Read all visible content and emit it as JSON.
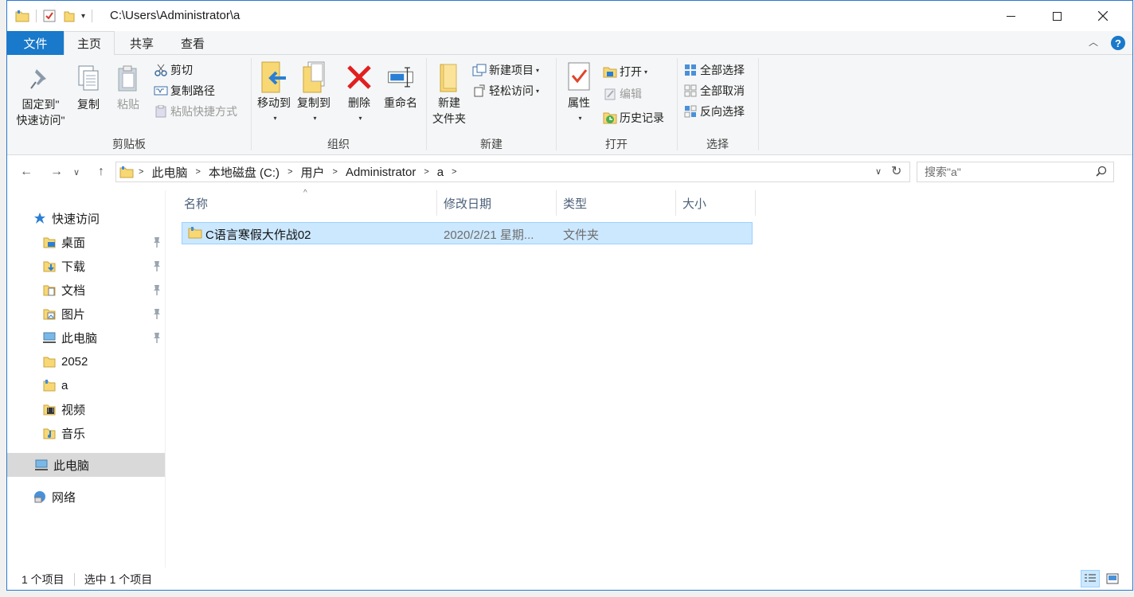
{
  "title_bar": {
    "path": "C:\\Users\\Administrator\\a",
    "minimize_icon": "minimize-icon",
    "maximize_icon": "maximize-icon",
    "close_icon": "close-icon"
  },
  "ribbon_tabs": [
    {
      "label": "文件"
    },
    {
      "label": "主页"
    },
    {
      "label": "共享"
    },
    {
      "label": "查看"
    }
  ],
  "ribbon": {
    "clipboard": {
      "group_label": "剪贴板",
      "pin_line1": "固定到\"",
      "pin_line2": "快速访问\"",
      "copy": "复制",
      "paste": "粘贴",
      "cut": "剪切",
      "copy_path": "复制路径",
      "paste_shortcut": "粘贴快捷方式"
    },
    "organize": {
      "group_label": "组织",
      "move_to": "移动到",
      "copy_to": "复制到",
      "delete": "删除",
      "rename": "重命名"
    },
    "new": {
      "group_label": "新建",
      "new_folder_line1": "新建",
      "new_folder_line2": "文件夹",
      "new_item": "新建项目",
      "easy_access": "轻松访问"
    },
    "open": {
      "group_label": "打开",
      "properties": "属性",
      "open": "打开",
      "edit": "编辑",
      "history": "历史记录"
    },
    "select": {
      "group_label": "选择",
      "select_all": "全部选择",
      "select_none": "全部取消",
      "invert": "反向选择"
    }
  },
  "address": {
    "crumbs": [
      "此电脑",
      "本地磁盘 (C:)",
      "用户",
      "Administrator",
      "a"
    ],
    "search_placeholder": "搜索\"a\""
  },
  "nav_pane": {
    "quick_access": "快速访问",
    "items": [
      {
        "label": "桌面",
        "icon": "desktop-folder-icon",
        "pinned": true
      },
      {
        "label": "下载",
        "icon": "downloads-folder-icon",
        "pinned": true
      },
      {
        "label": "文档",
        "icon": "documents-folder-icon",
        "pinned": true
      },
      {
        "label": "图片",
        "icon": "pictures-folder-icon",
        "pinned": true
      },
      {
        "label": "此电脑",
        "icon": "computer-icon",
        "pinned": true
      },
      {
        "label": "2052",
        "icon": "folder-icon",
        "pinned": false
      },
      {
        "label": "a",
        "icon": "user-folder-icon",
        "pinned": false
      },
      {
        "label": "视频",
        "icon": "videos-folder-icon",
        "pinned": false
      },
      {
        "label": "音乐",
        "icon": "music-folder-icon",
        "pinned": false
      }
    ],
    "this_pc": "此电脑",
    "network": "网络"
  },
  "columns": [
    "名称",
    "修改日期",
    "类型",
    "大小"
  ],
  "files": [
    {
      "name": "C语言寒假大作战02",
      "date": "2020/2/21 星期...",
      "type": "文件夹",
      "size": ""
    }
  ],
  "status": {
    "count": "1 个项目",
    "selected": "选中 1 个项目"
  },
  "colors": {
    "accent": "#1979ca",
    "selection": "#cce8ff",
    "folder": "#f8d775"
  }
}
